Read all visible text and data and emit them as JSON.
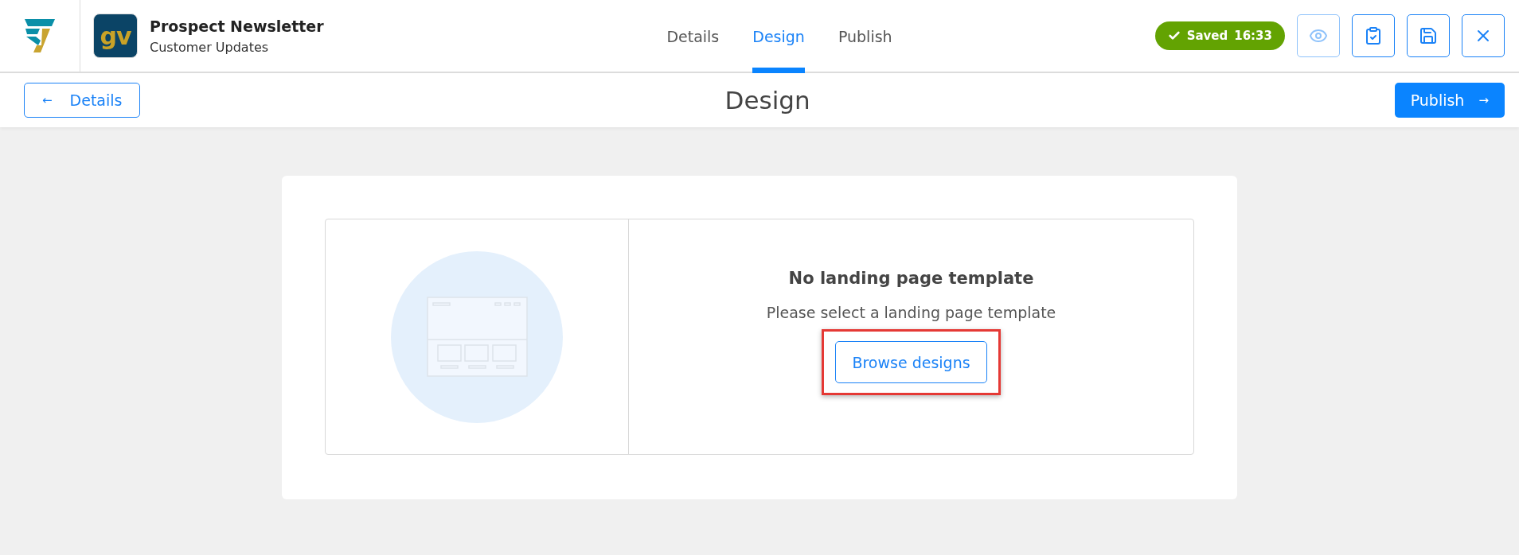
{
  "app": {
    "logo_text": "gv",
    "title": "Prospect Newsletter",
    "subtitle": "Customer Updates"
  },
  "tabs": [
    {
      "label": "Details",
      "selected": false
    },
    {
      "label": "Design",
      "selected": true
    },
    {
      "label": "Publish",
      "selected": false
    }
  ],
  "status_badge": {
    "label": "Saved",
    "time": "16:33"
  },
  "toolbar_buttons": [
    {
      "kind": "preview",
      "disabled": true
    },
    {
      "kind": "checklist",
      "disabled": false
    },
    {
      "kind": "save",
      "disabled": false
    },
    {
      "kind": "close",
      "disabled": false
    }
  ],
  "subbar": {
    "back_button": {
      "arrow": "←",
      "label": "Details"
    },
    "heading": "Design",
    "next_button": {
      "label": "Publish",
      "arrow": "→"
    }
  },
  "empty_state": {
    "title": "No landing page template",
    "message": "Please select a landing page template",
    "button": {
      "label": "Browse designs",
      "highlighted": true
    }
  }
}
